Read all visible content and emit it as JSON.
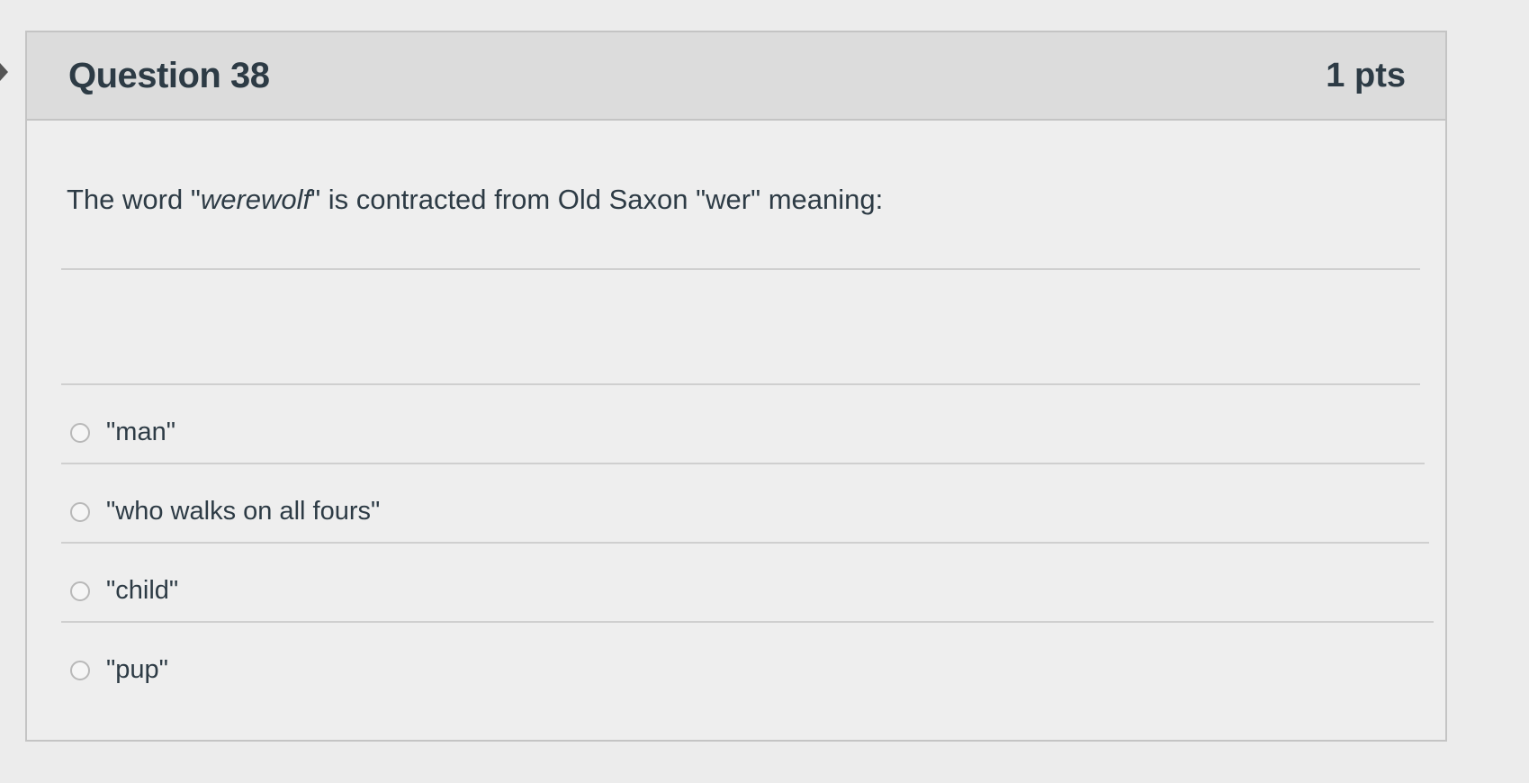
{
  "question": {
    "title": "Question 38",
    "points": "1 pts",
    "text_before": "The word \"",
    "text_em": "werewolf",
    "text_after": "\" is contracted from Old Saxon \"wer\" meaning:"
  },
  "answers": [
    {
      "label": "\"man\"",
      "selected": false
    },
    {
      "label": "\"who walks on all fours\"",
      "selected": false
    },
    {
      "label": "\"child\"",
      "selected": false
    },
    {
      "label": "\"pup\"",
      "selected": false
    }
  ],
  "icons": {
    "radio": "radio-button-icon",
    "edge": "chevron-right-icon"
  }
}
